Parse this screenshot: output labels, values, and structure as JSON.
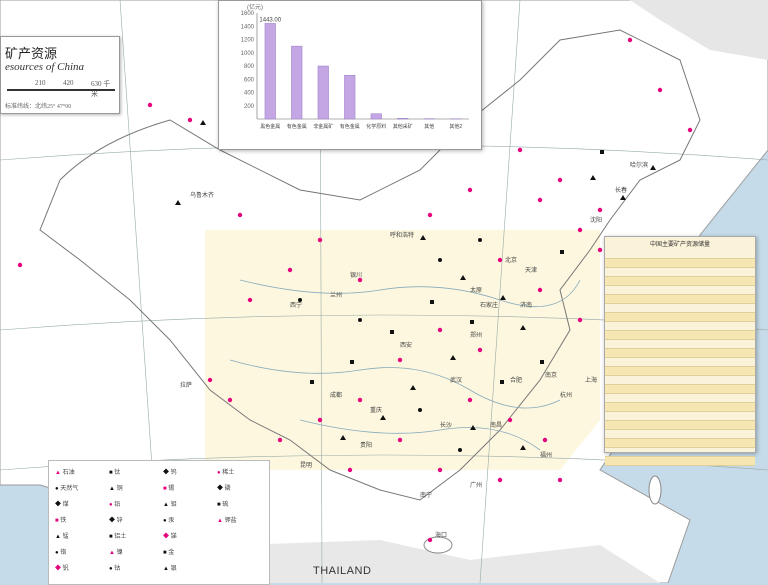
{
  "title_box": {
    "title_cn": "矿产资源",
    "title_en": "esources of China",
    "scale_values": [
      "210",
      "420",
      "630 千米"
    ],
    "note": "标准纬线：北纬25° 47°00"
  },
  "chart": {
    "ylabel": "(亿元)",
    "yticks": [
      "1600",
      "1400",
      "1200",
      "1000",
      "800",
      "600",
      "400",
      "200"
    ],
    "top_value": "1443.00",
    "categories": [
      "黑色金属矿采选业",
      "有色金属矿采选业",
      "非金属矿采选业",
      "有色金属冶炼及压延",
      "化学原料制造业",
      "其他采矿业",
      "其他",
      "其他2"
    ]
  },
  "chart_data": {
    "type": "bar",
    "categories": [
      "黑色金属矿采选业",
      "有色金属矿采选业",
      "非金属矿采选业",
      "有色金属冶炼及压延",
      "化学原料制造业",
      "其他采矿业",
      "其他",
      "其他2"
    ],
    "values": [
      1443,
      1100,
      800,
      660,
      80,
      10,
      5,
      3
    ],
    "ylabel": "(亿元)",
    "ylim": [
      0,
      1600
    ]
  },
  "table": {
    "title": "中国主要矿产资源储量"
  },
  "legend": {
    "items": [
      "石油",
      "天然气",
      "煤",
      "铁",
      "锰",
      "铬",
      "钒",
      "钛",
      "铜",
      "铅",
      "锌",
      "铝土",
      "镍",
      "钴",
      "钨",
      "锡",
      "钼",
      "汞",
      "锑",
      "金",
      "银",
      "稀土",
      "磷",
      "硫",
      "钾盐"
    ]
  },
  "map_labels": {
    "country": "THAILAND",
    "cities": [
      "哈尔滨",
      "长春",
      "沈阳",
      "北京",
      "天津",
      "太原",
      "石家庄",
      "济南",
      "郑州",
      "西安",
      "兰州",
      "西宁",
      "拉萨",
      "成都",
      "重庆",
      "武汉",
      "长沙",
      "南昌",
      "杭州",
      "上海",
      "南京",
      "合肥",
      "福州",
      "广州",
      "南宁",
      "海口",
      "昆明",
      "贵阳",
      "乌鲁木齐",
      "呼和浩特",
      "银川"
    ]
  },
  "colors": {
    "sea": "#c6dbe9",
    "land": "#ffffff",
    "yellow_zone": "#fbf6d8",
    "magenta": "#e6007e",
    "black": "#111111",
    "bar": "#b79ad8"
  }
}
